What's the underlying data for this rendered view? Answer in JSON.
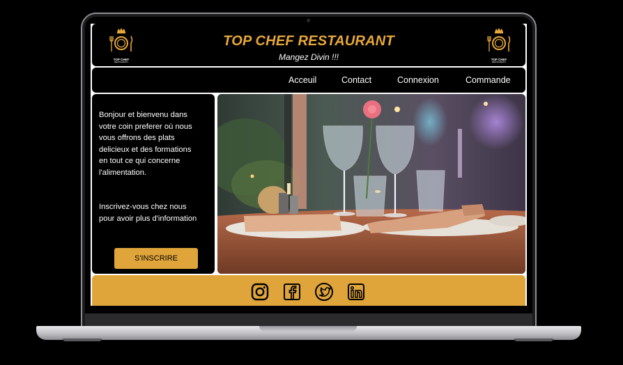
{
  "site": {
    "title": "TOP CHEF RESTAURANT",
    "tagline": "Mangez Divin !!!",
    "logo_text": "TOP CHEF",
    "logo_sub": "RESTAURANT"
  },
  "nav": {
    "items": [
      "Acceuil",
      "Contact",
      "Connexion",
      "Commande"
    ]
  },
  "intro": {
    "welcome": "Bonjour et bienvenu dans\nvotre coin preferer où nous\nvous offrons des plats\ndelicieux et des formations\n en tout ce qui concerne\nl'alimentation.",
    "cta_text": "Inscrivez-vous chez nous\npour avoir plus d'information",
    "signup_label": "S'INSCRIRE"
  },
  "footer": {
    "socials": [
      "instagram-icon",
      "facebook-icon",
      "twitter-icon",
      "linkedin-icon"
    ]
  },
  "colors": {
    "accent": "#e8a838",
    "footer": "#dfa53a",
    "background": "#000000"
  }
}
